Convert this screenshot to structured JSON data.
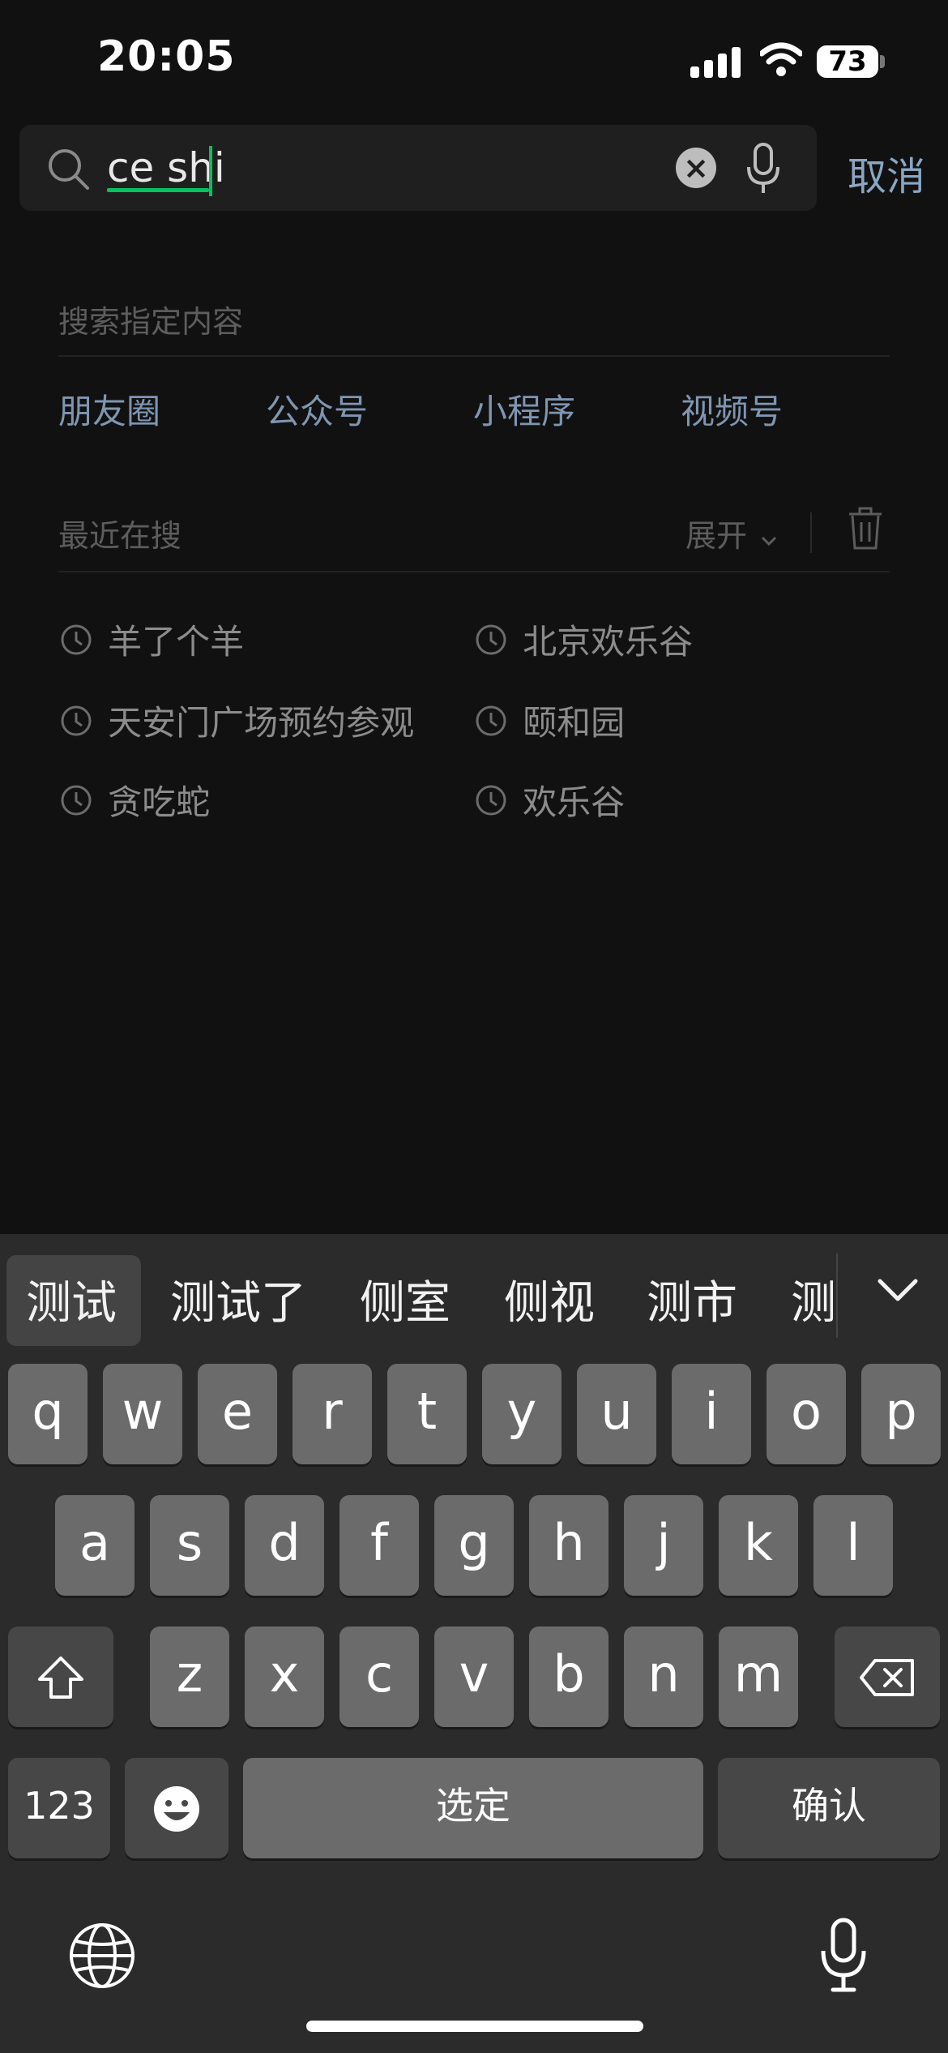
{
  "status_bar": {
    "time": "20:05",
    "battery": "73"
  },
  "search": {
    "query": "ce shi",
    "cancel_label": "取消"
  },
  "specify": {
    "title": "搜索指定内容",
    "categories": [
      "朋友圈",
      "公众号",
      "小程序",
      "视频号"
    ]
  },
  "recent": {
    "title": "最近在搜",
    "expand_label": "展开",
    "items": [
      "羊了个羊",
      "北京欢乐谷",
      "天安门广场预约参观",
      "颐和园",
      "贪吃蛇",
      "欢乐谷"
    ]
  },
  "keyboard": {
    "candidates": [
      "测试",
      "测试了",
      "侧室",
      "侧视",
      "测市",
      "测"
    ],
    "row1": [
      "q",
      "w",
      "e",
      "r",
      "t",
      "y",
      "u",
      "i",
      "o",
      "p"
    ],
    "row2": [
      "a",
      "s",
      "d",
      "f",
      "g",
      "h",
      "j",
      "k",
      "l"
    ],
    "row3": [
      "z",
      "x",
      "c",
      "v",
      "b",
      "n",
      "m"
    ],
    "numbers_label": "123",
    "space_label": "选定",
    "confirm_label": "确认"
  },
  "colors": {
    "accent": "#07c160",
    "link": "#7f96b2"
  }
}
